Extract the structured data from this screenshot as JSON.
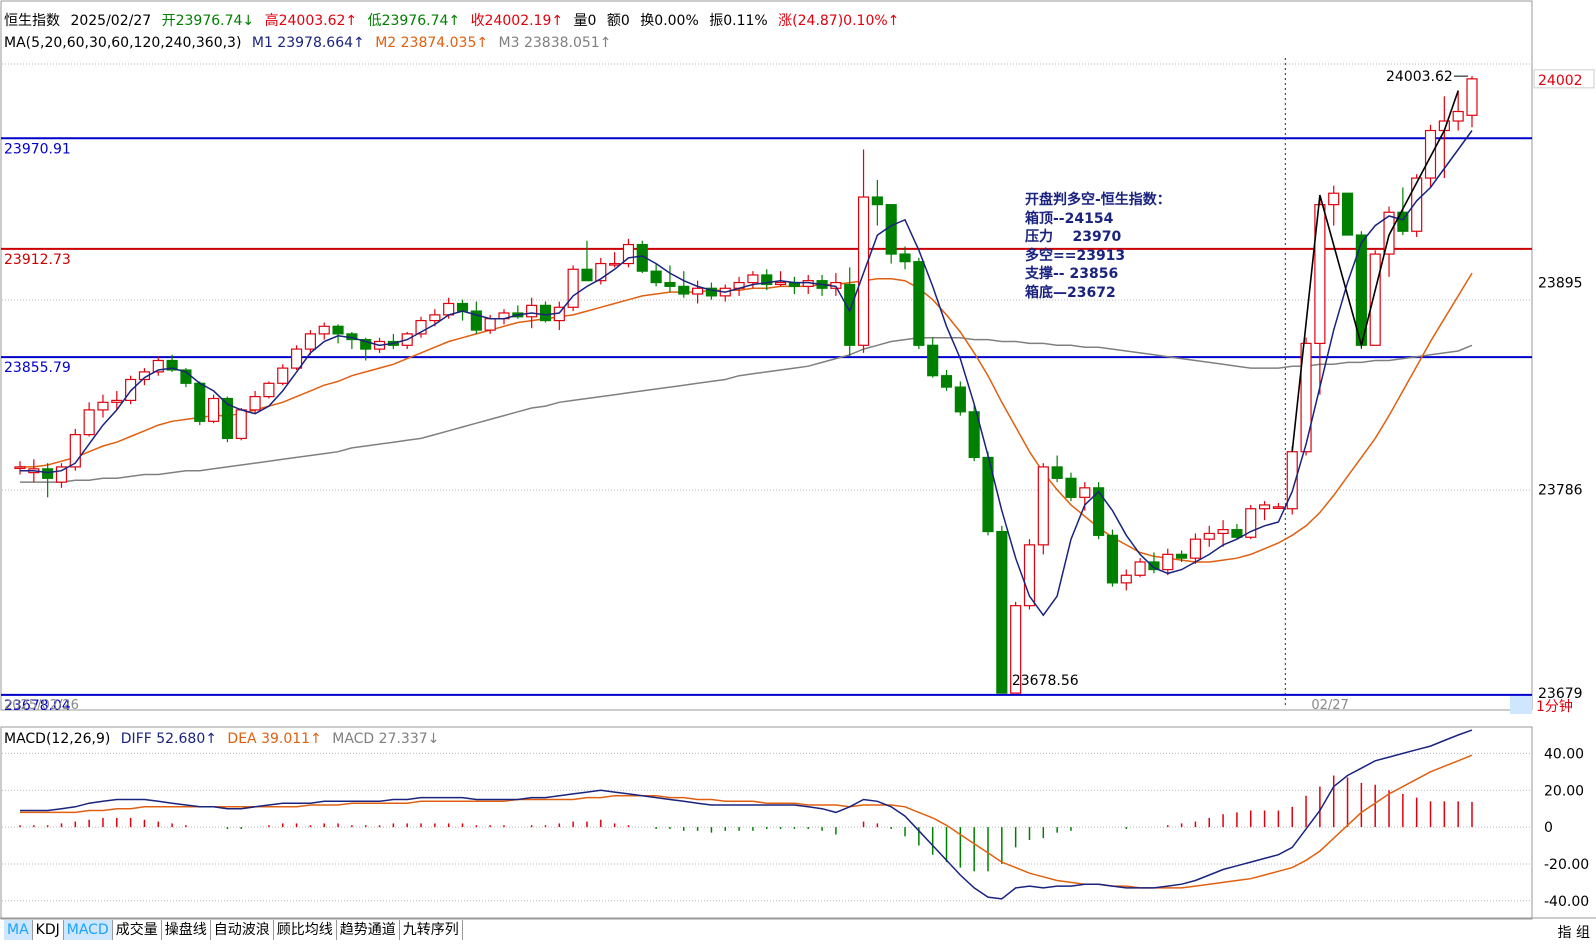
{
  "header": {
    "name": "恒生指数",
    "date": "2025/02/27",
    "open": "开23976.74↓",
    "high": "高24003.62↑",
    "low": "低23976.74↑",
    "close": "收24002.19↑",
    "vol": "量0",
    "amt": "额0",
    "turnover": "换0.00%",
    "amplitude": "振0.11%",
    "change": "涨(24.87)0.10%↑"
  },
  "ma_line": {
    "label": "MA(5,20,60,30,60,120,240,360,3)",
    "m1": "M1 23978.664↑",
    "m2": "M2 23874.035↑",
    "m3": "M3 23838.051↑"
  },
  "macd_line": {
    "label": "MACD(12,26,9)",
    "diff": "DIFF 52.680↑",
    "dea": "DEA 39.011↑",
    "macd": "MACD 27.337↓"
  },
  "hlines": [
    {
      "value": "23970.91",
      "color": "#0000cc"
    },
    {
      "value": "23912.73",
      "color": "#cc0000"
    },
    {
      "value": "23855.79",
      "color": "#0000cc"
    },
    {
      "value": "23678.04",
      "color": "#0000cc"
    }
  ],
  "price_labels": {
    "current": "24002",
    "peak": "24003.62",
    "trough": "23678.56"
  },
  "y_ticks": [
    "23895",
    "23786",
    "23679"
  ],
  "macd_ticks": [
    "40.00",
    "20.00",
    "0",
    "-20.00",
    "-40.00"
  ],
  "x_labels": {
    "left": "2025/02/26",
    "right": "02/27",
    "period": "1分钟"
  },
  "annotation": {
    "title": "开盘判多空-恒生指数：",
    "lines": [
      "箱顶--24154",
      "压力    23970",
      "多空==23913",
      "支撑-- 23856",
      "箱底—23672"
    ]
  },
  "tabs": [
    "MA",
    "KDJ",
    "MACD",
    "成交量",
    "操盘线",
    "自动波浪",
    "顾比均线",
    "趋势通道",
    "九转序列"
  ],
  "corner": "指 组",
  "colors": {
    "up": "#e0000e",
    "down": "#008000",
    "m1": "#1a237e",
    "m2": "#e06010",
    "m3": "#808080"
  },
  "chart_data": {
    "type": "candlestick",
    "ylim": [
      23678,
      24010
    ],
    "macd_ylim": [
      -45,
      50
    ],
    "candles": [
      [
        23798,
        23801,
        23794,
        23798
      ],
      [
        23795,
        23802,
        23790,
        23797
      ],
      [
        23797,
        23800,
        23782,
        23792
      ],
      [
        23790,
        23800,
        23787,
        23798
      ],
      [
        23798,
        23818,
        23796,
        23815
      ],
      [
        23815,
        23832,
        23814,
        23828
      ],
      [
        23828,
        23836,
        23824,
        23832
      ],
      [
        23832,
        23838,
        23828,
        23833
      ],
      [
        23833,
        23846,
        23831,
        23844
      ],
      [
        23844,
        23850,
        23841,
        23848
      ],
      [
        23848,
        23856,
        23846,
        23854
      ],
      [
        23854,
        23857,
        23848,
        23849
      ],
      [
        23849,
        23850,
        23840,
        23842
      ],
      [
        23842,
        23843,
        23820,
        23822
      ],
      [
        23822,
        23836,
        23821,
        23834
      ],
      [
        23834,
        23835,
        23811,
        23813
      ],
      [
        23813,
        23829,
        23812,
        23828
      ],
      [
        23828,
        23838,
        23826,
        23835
      ],
      [
        23835,
        23843,
        23834,
        23842
      ],
      [
        23842,
        23852,
        23841,
        23850
      ],
      [
        23850,
        23862,
        23849,
        23860
      ],
      [
        23860,
        23870,
        23857,
        23868
      ],
      [
        23868,
        23874,
        23865,
        23872
      ],
      [
        23872,
        23873,
        23863,
        23868
      ],
      [
        23868,
        23869,
        23860,
        23865
      ],
      [
        23865,
        23866,
        23854,
        23860
      ],
      [
        23860,
        23866,
        23858,
        23864
      ],
      [
        23864,
        23868,
        23860,
        23862
      ],
      [
        23862,
        23869,
        23860,
        23868
      ],
      [
        23868,
        23877,
        23866,
        23875
      ],
      [
        23875,
        23881,
        23872,
        23878
      ],
      [
        23878,
        23887,
        23876,
        23884
      ],
      [
        23884,
        23886,
        23875,
        23880
      ],
      [
        23880,
        23885,
        23868,
        23870
      ],
      [
        23870,
        23878,
        23868,
        23876
      ],
      [
        23876,
        23881,
        23873,
        23879
      ],
      [
        23879,
        23883,
        23876,
        23877
      ],
      [
        23877,
        23887,
        23871,
        23883
      ],
      [
        23883,
        23885,
        23874,
        23875
      ],
      [
        23875,
        23885,
        23870,
        23882
      ],
      [
        23882,
        23904,
        23880,
        23902
      ],
      [
        23902,
        23917,
        23896,
        23896
      ],
      [
        23896,
        23908,
        23894,
        23905
      ],
      [
        23905,
        23911,
        23903,
        23905
      ],
      [
        23905,
        23918,
        23903,
        23915
      ],
      [
        23915,
        23917,
        23900,
        23901
      ],
      [
        23901,
        23905,
        23893,
        23895
      ],
      [
        23895,
        23904,
        23890,
        23893
      ],
      [
        23893,
        23901,
        23887,
        23889
      ],
      [
        23889,
        23896,
        23884,
        23892
      ],
      [
        23892,
        23895,
        23886,
        23888
      ],
      [
        23888,
        23894,
        23885,
        23892
      ],
      [
        23892,
        23898,
        23888,
        23895
      ],
      [
        23895,
        23901,
        23892,
        23899
      ],
      [
        23899,
        23902,
        23891,
        23894
      ],
      [
        23894,
        23901,
        23893,
        23895
      ],
      [
        23895,
        23898,
        23889,
        23893
      ],
      [
        23893,
        23899,
        23889,
        23896
      ],
      [
        23896,
        23899,
        23888,
        23892
      ],
      [
        23892,
        23900,
        23888,
        23895
      ],
      [
        23894,
        23903,
        23856,
        23862
      ],
      [
        23862,
        23965,
        23858,
        23940
      ],
      [
        23940,
        23949,
        23925,
        23936
      ],
      [
        23936,
        23930,
        23905,
        23910
      ],
      [
        23910,
        23914,
        23902,
        23906
      ],
      [
        23906,
        23908,
        23860,
        23862
      ],
      [
        23862,
        23866,
        23845,
        23846
      ],
      [
        23846,
        23849,
        23838,
        23840
      ],
      [
        23840,
        23843,
        23825,
        23827
      ],
      [
        23827,
        23831,
        23801,
        23803
      ],
      [
        23803,
        23806,
        23762,
        23764
      ],
      [
        23764,
        23767,
        23679,
        23679
      ],
      [
        23679,
        23727,
        23679,
        23725
      ],
      [
        23725,
        23760,
        23723,
        23757
      ],
      [
        23757,
        23800,
        23752,
        23798
      ],
      [
        23798,
        23804,
        23790,
        23792
      ],
      [
        23792,
        23795,
        23780,
        23782
      ],
      [
        23782,
        23790,
        23775,
        23787
      ],
      [
        23787,
        23790,
        23760,
        23762
      ],
      [
        23762,
        23765,
        23735,
        23737
      ],
      [
        23737,
        23744,
        23733,
        23741
      ],
      [
        23741,
        23750,
        23740,
        23748
      ],
      [
        23748,
        23753,
        23742,
        23744
      ],
      [
        23744,
        23755,
        23741,
        23752
      ],
      [
        23752,
        23754,
        23748,
        23750
      ],
      [
        23750,
        23763,
        23747,
        23760
      ],
      [
        23760,
        23767,
        23756,
        23763
      ],
      [
        23763,
        23770,
        23756,
        23765
      ],
      [
        23765,
        23768,
        23760,
        23761
      ],
      [
        23761,
        23778,
        23760,
        23776
      ],
      [
        23776,
        23780,
        23770,
        23778
      ],
      [
        23777,
        23779,
        23776,
        23777
      ],
      [
        23776,
        23809,
        23773,
        23806
      ],
      [
        23806,
        23866,
        23804,
        23863
      ],
      [
        23863,
        23941,
        23836,
        23936
      ],
      [
        23936,
        23946,
        23925,
        23942
      ],
      [
        23942,
        23939,
        23920,
        23920
      ],
      [
        23920,
        23922,
        23860,
        23862
      ],
      [
        23862,
        23912,
        23862,
        23910
      ],
      [
        23910,
        23935,
        23898,
        23932
      ],
      [
        23932,
        23945,
        23920,
        23922
      ],
      [
        23922,
        23952,
        23919,
        23950
      ],
      [
        23950,
        23978,
        23945,
        23975
      ],
      [
        23975,
        23993,
        23950,
        23980
      ],
      [
        23980,
        23996,
        23975,
        23985
      ],
      [
        23983,
        24003.62,
        23976.74,
        24002.19
      ]
    ],
    "m1": [
      23796,
      23796,
      23795,
      23796,
      23800,
      23810,
      23820,
      23828,
      23838,
      23845,
      23849,
      23850,
      23848,
      23842,
      23838,
      23831,
      23828,
      23826,
      23830,
      23838,
      23848,
      23858,
      23864,
      23867,
      23866,
      23864,
      23862,
      23863,
      23865,
      23869,
      23873,
      23878,
      23880,
      23878,
      23876,
      23876,
      23878,
      23879,
      23878,
      23879,
      23888,
      23893,
      23897,
      23902,
      23908,
      23909,
      23905,
      23900,
      23896,
      23893,
      23891,
      23890,
      23892,
      23894,
      23895,
      23896,
      23895,
      23895,
      23894,
      23893,
      23880,
      23900,
      23920,
      23925,
      23928,
      23912,
      23893,
      23872,
      23855,
      23831,
      23804,
      23775,
      23750,
      23730,
      23720,
      23730,
      23760,
      23778,
      23785,
      23775,
      23762,
      23752,
      23745,
      23742,
      23744,
      23748,
      23752,
      23757,
      23760,
      23764,
      23767,
      23769,
      23785,
      23810,
      23840,
      23870,
      23895,
      23916,
      23925,
      23930,
      23928,
      23938,
      23945,
      23955,
      23965,
      23975
    ],
    "m2": [
      23798,
      23798,
      23799,
      23801,
      23803,
      23806,
      23809,
      23811,
      23814,
      23817,
      23820,
      23822,
      23823,
      23824,
      23825,
      23825,
      23826,
      23828,
      23830,
      23832,
      23835,
      23838,
      23841,
      23843,
      23846,
      23848,
      23850,
      23852,
      23855,
      23858,
      23861,
      23864,
      23866,
      23868,
      23870,
      23872,
      23874,
      23875,
      23876,
      23877,
      23878,
      23880,
      23882,
      23884,
      23886,
      23888,
      23889,
      23890,
      23890,
      23890,
      23891,
      23891,
      23891,
      23892,
      23892,
      23893,
      23893,
      23893,
      23894,
      23894,
      23895,
      23896,
      23897,
      23897,
      23896,
      23892,
      23886,
      23878,
      23869,
      23858,
      23846,
      23832,
      23819,
      23806,
      23795,
      23786,
      23778,
      23772,
      23766,
      23761,
      23757,
      23753,
      23751,
      23750,
      23749,
      23748,
      23748,
      23749,
      23750,
      23752,
      23755,
      23758,
      23762,
      23767,
      23774,
      23783,
      23793,
      23803,
      23813,
      23825,
      23838,
      23851,
      23864,
      23876,
      23888,
      23900
    ],
    "m3": [
      23790,
      23790,
      23790,
      23790,
      23791,
      23791,
      23792,
      23792,
      23793,
      23794,
      23794,
      23795,
      23796,
      23796,
      23797,
      23798,
      23799,
      23800,
      23801,
      23802,
      23803,
      23804,
      23805,
      23806,
      23808,
      23809,
      23810,
      23811,
      23812,
      23813,
      23815,
      23817,
      23819,
      23821,
      23823,
      23825,
      23827,
      23829,
      23830,
      23832,
      23833,
      23834,
      23835,
      23836,
      23837,
      23838,
      23839,
      23840,
      23841,
      23842,
      23843,
      23844,
      23846,
      23847,
      23848,
      23849,
      23850,
      23851,
      23853,
      23855,
      23857,
      23860,
      23862,
      23864,
      23865,
      23866,
      23866,
      23866,
      23866,
      23865,
      23865,
      23864,
      23864,
      23863,
      23863,
      23862,
      23862,
      23861,
      23861,
      23860,
      23859,
      23858,
      23857,
      23856,
      23855,
      23854,
      23853,
      23852,
      23851,
      23850,
      23850,
      23850,
      23851,
      23851,
      23852,
      23852,
      23853,
      23853,
      23854,
      23854,
      23855,
      23856,
      23857,
      23858,
      23859,
      23862
    ],
    "diff": [
      9,
      9,
      9,
      10,
      11,
      13,
      14,
      15,
      15,
      15,
      14,
      13,
      12,
      11,
      11,
      10,
      10,
      11,
      12,
      13,
      13,
      13,
      14,
      14,
      14,
      14,
      14,
      15,
      15,
      16,
      16,
      16,
      16,
      15,
      15,
      15,
      15,
      16,
      16,
      17,
      18,
      19,
      20,
      19,
      18,
      17,
      16,
      15,
      14,
      13,
      12,
      12,
      12,
      12,
      12,
      12,
      12,
      11,
      10,
      8,
      11,
      15,
      14,
      11,
      6,
      -2,
      -10,
      -18,
      -26,
      -33,
      -38,
      -39,
      -33,
      -32,
      -33,
      -32,
      -32,
      -31,
      -31,
      -32,
      -33,
      -33,
      -33,
      -32,
      -31,
      -29,
      -26,
      -23,
      -21,
      -19,
      -17,
      -15,
      -11,
      -1,
      9,
      22,
      28,
      32,
      36,
      38,
      40,
      42,
      44,
      47,
      50,
      52.68
    ],
    "dea": [
      8,
      8,
      8,
      8,
      8,
      9,
      9,
      10,
      10,
      11,
      11,
      11,
      11,
      11,
      11,
      11,
      11,
      11,
      11,
      11,
      11,
      12,
      12,
      12,
      13,
      13,
      13,
      13,
      13,
      14,
      14,
      14,
      14,
      14,
      14,
      14,
      15,
      15,
      15,
      15,
      15,
      16,
      16,
      17,
      17,
      17,
      17,
      16,
      16,
      15,
      15,
      14,
      14,
      14,
      13,
      13,
      13,
      12,
      12,
      12,
      11,
      12,
      12,
      12,
      11,
      8,
      5,
      1,
      -4,
      -9,
      -14,
      -19,
      -22,
      -25,
      -27,
      -29,
      -30,
      -31,
      -31,
      -32,
      -32,
      -33,
      -33,
      -33,
      -33,
      -32,
      -31,
      -30,
      -29,
      -28,
      -26,
      -24,
      -22,
      -18,
      -13,
      -6,
      1,
      8,
      13,
      18,
      22,
      26,
      30,
      33,
      36,
      39.011
    ],
    "macd": [
      1,
      1,
      1,
      2,
      3,
      4,
      5,
      5,
      5,
      4,
      3,
      2,
      1,
      0,
      0,
      -1,
      -1,
      0,
      1,
      2,
      2,
      1,
      2,
      2,
      1,
      1,
      1,
      2,
      2,
      2,
      2,
      2,
      2,
      1,
      1,
      1,
      0,
      1,
      1,
      2,
      3,
      3,
      4,
      2,
      1,
      0,
      -1,
      -1,
      -2,
      -2,
      -3,
      -2,
      -2,
      -2,
      -1,
      -1,
      -1,
      -1,
      -2,
      -4,
      0,
      3,
      2,
      -1,
      -5,
      -10,
      -15,
      -19,
      -22,
      -24,
      -24,
      -20,
      -11,
      -7,
      -6,
      -3,
      -2,
      0,
      0,
      0,
      -1,
      0,
      0,
      1,
      2,
      3,
      5,
      7,
      8,
      9,
      9,
      9,
      11,
      17,
      22,
      28,
      27,
      24,
      23,
      20,
      18,
      16,
      14,
      14,
      14,
      13.67
    ]
  }
}
